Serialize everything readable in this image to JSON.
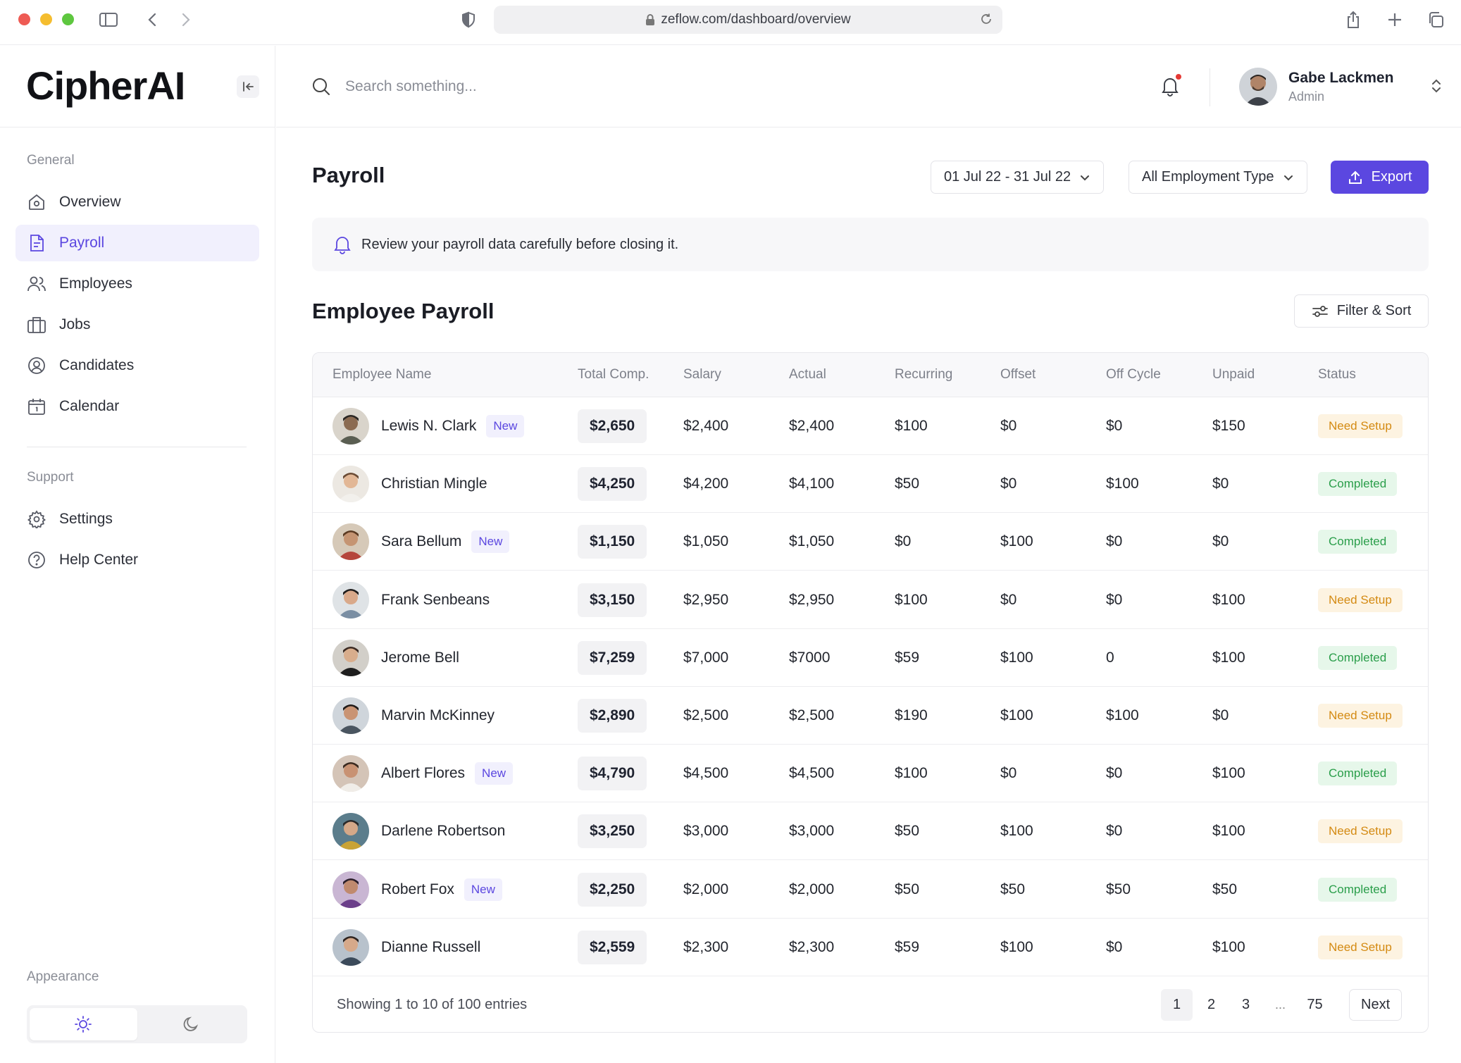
{
  "browser": {
    "url": "zeflow.com/dashboard/overview"
  },
  "app": {
    "logo": "CipherAI"
  },
  "sidebar": {
    "general_heading": "General",
    "general_items": [
      {
        "label": "Overview",
        "icon": "home-icon"
      },
      {
        "label": "Payroll",
        "icon": "document-icon",
        "active": true
      },
      {
        "label": "Employees",
        "icon": "users-icon"
      },
      {
        "label": "Jobs",
        "icon": "briefcase-icon"
      },
      {
        "label": "Candidates",
        "icon": "user-circle-icon"
      },
      {
        "label": "Calendar",
        "icon": "calendar-icon"
      }
    ],
    "support_heading": "Support",
    "support_items": [
      {
        "label": "Settings",
        "icon": "gear-icon"
      },
      {
        "label": "Help Center",
        "icon": "help-circle-icon"
      }
    ],
    "appearance_label": "Appearance",
    "theme_selected": "light"
  },
  "topbar": {
    "search_placeholder": "Search something...",
    "user": {
      "name": "Gabe Lackmen",
      "role": "Admin"
    }
  },
  "main": {
    "title": "Payroll",
    "date_range": "01 Jul 22 - 31 Jul 22",
    "employment_filter": "All Employment Type",
    "export_label": "Export",
    "notice": "Review your payroll data carefully before closing it.",
    "section_title": "Employee Payroll",
    "filter_sort_label": "Filter & Sort"
  },
  "table": {
    "columns": [
      "Employee Name",
      "Total Comp.",
      "Salary",
      "Actual",
      "Recurring",
      "Offset",
      "Off Cycle",
      "Unpaid",
      "Status"
    ],
    "new_badge_label": "New",
    "rows": [
      {
        "name": "Lewis N. Clark",
        "is_new": true,
        "total": "$2,650",
        "salary": "$2,400",
        "actual": "$2,400",
        "recurring": "$100",
        "offset": "$0",
        "off_cycle": "$0",
        "unpaid": "$150",
        "status": "Need Setup"
      },
      {
        "name": "Christian Mingle",
        "is_new": false,
        "total": "$4,250",
        "salary": "$4,200",
        "actual": "$4,100",
        "recurring": "$50",
        "offset": "$0",
        "off_cycle": "$100",
        "unpaid": "$0",
        "status": "Completed"
      },
      {
        "name": "Sara Bellum",
        "is_new": true,
        "total": "$1,150",
        "salary": "$1,050",
        "actual": "$1,050",
        "recurring": "$0",
        "offset": "$100",
        "off_cycle": "$0",
        "unpaid": "$0",
        "status": "Completed"
      },
      {
        "name": "Frank Senbeans",
        "is_new": false,
        "total": "$3,150",
        "salary": "$2,950",
        "actual": "$2,950",
        "recurring": "$100",
        "offset": "$0",
        "off_cycle": "$0",
        "unpaid": "$100",
        "status": "Need Setup"
      },
      {
        "name": "Jerome Bell",
        "is_new": false,
        "total": "$7,259",
        "salary": "$7,000",
        "actual": "$7000",
        "recurring": "$59",
        "offset": "$100",
        "off_cycle": "0",
        "unpaid": "$100",
        "status": "Completed"
      },
      {
        "name": "Marvin McKinney",
        "is_new": false,
        "total": "$2,890",
        "salary": "$2,500",
        "actual": "$2,500",
        "recurring": "$190",
        "offset": "$100",
        "off_cycle": "$100",
        "unpaid": "$0",
        "status": "Need Setup"
      },
      {
        "name": "Albert Flores",
        "is_new": true,
        "total": "$4,790",
        "salary": "$4,500",
        "actual": "$4,500",
        "recurring": "$100",
        "offset": "$0",
        "off_cycle": "$0",
        "unpaid": "$100",
        "status": "Completed"
      },
      {
        "name": "Darlene Robertson",
        "is_new": false,
        "total": "$3,250",
        "salary": "$3,000",
        "actual": "$3,000",
        "recurring": "$50",
        "offset": "$100",
        "off_cycle": "$0",
        "unpaid": "$100",
        "status": "Need Setup"
      },
      {
        "name": "Robert Fox",
        "is_new": true,
        "total": "$2,250",
        "salary": "$2,000",
        "actual": "$2,000",
        "recurring": "$50",
        "offset": "$50",
        "off_cycle": "$50",
        "unpaid": "$50",
        "status": "Completed"
      },
      {
        "name": "Dianne Russell",
        "is_new": false,
        "total": "$2,559",
        "salary": "$2,300",
        "actual": "$2,300",
        "recurring": "$59",
        "offset": "$100",
        "off_cycle": "$0",
        "unpaid": "$100",
        "status": "Need Setup"
      }
    ]
  },
  "pagination": {
    "showing": "Showing 1 to 10 of 100 entries",
    "pages": [
      "1",
      "2",
      "3"
    ],
    "ellipsis": "...",
    "last_page": "75",
    "current_page": "1",
    "next_label": "Next"
  },
  "colors": {
    "accent": "#5b47e0",
    "accent_soft": "#f1f0fd",
    "status_setup_bg": "#fdf3e1",
    "status_setup_text": "#d48a12",
    "status_done_bg": "#e6f7ea",
    "status_done_text": "#2a9e4a"
  }
}
